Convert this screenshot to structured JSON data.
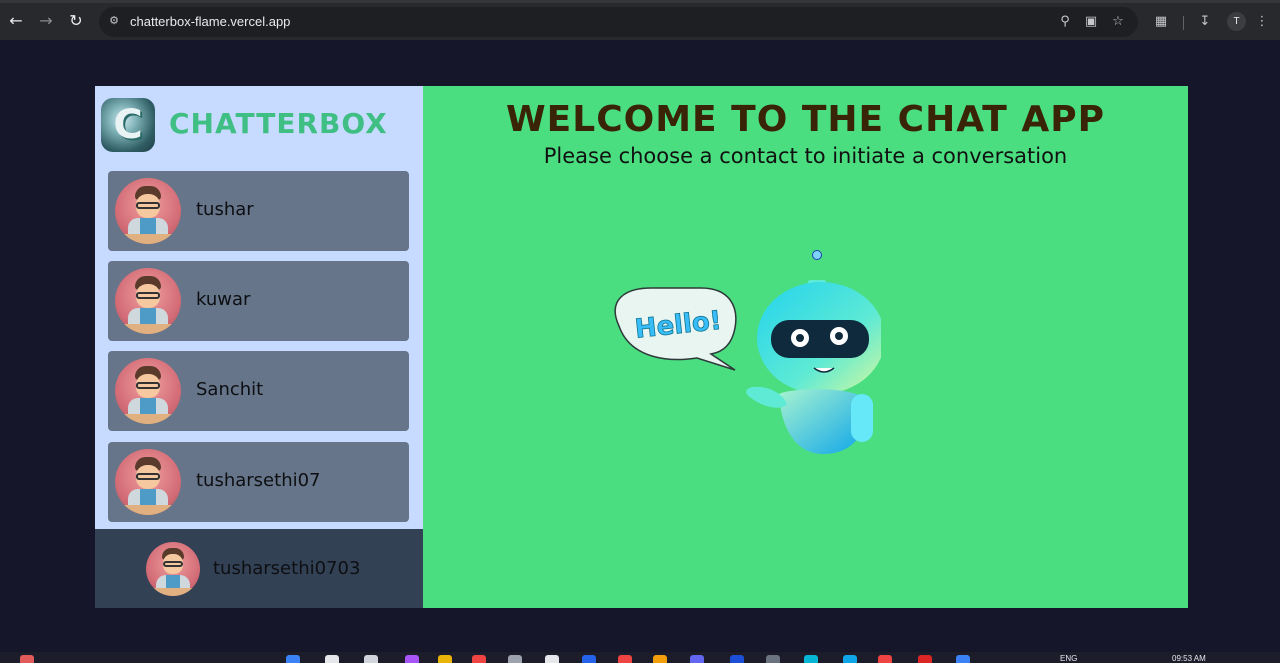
{
  "browser": {
    "url": "chatterbox-flame.vercel.app",
    "profile_initial": "T"
  },
  "sidebar": {
    "brand_name": "CHATTERBOX",
    "logo_letter": "C",
    "contacts": [
      {
        "name": "tushar"
      },
      {
        "name": "kuwar"
      },
      {
        "name": "Sanchit"
      },
      {
        "name": "tusharsethi07"
      }
    ],
    "current_user": {
      "name": "tusharsethi0703"
    }
  },
  "main": {
    "title": "WELCOME TO THE CHAT APP",
    "subtitle": "Please choose a contact to initiate a conversation",
    "bubble_text": "Hello!"
  },
  "taskbar": {
    "lang": "ENG",
    "time": "09:53 AM"
  },
  "colors": {
    "sidebar_bg": "#c6dbff",
    "brand": "#3fbf84",
    "contact_card": "#667589",
    "current_user_bg": "#334155",
    "main_bg": "#4ade80",
    "title": "#3a2408"
  }
}
